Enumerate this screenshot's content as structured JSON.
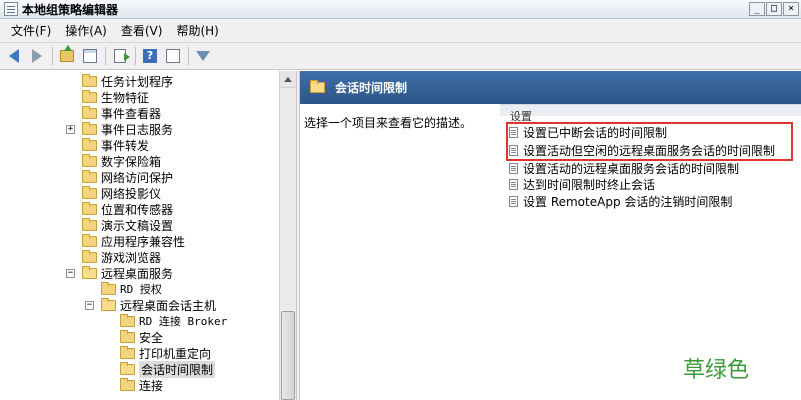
{
  "window": {
    "title": "本地组策略编辑器",
    "controls": [
      "_",
      "□",
      "×"
    ]
  },
  "menu": [
    "文件(F)",
    "操作(A)",
    "查看(V)",
    "帮助(H)"
  ],
  "toolbar": {
    "icons": [
      "back-arrow-icon",
      "forward-arrow-icon",
      "up-folder-icon",
      "show-hide-tree-icon",
      "export-list-icon",
      "help-icon",
      "properties-view-icon",
      "filter-icon"
    ]
  },
  "tree": {
    "items": [
      {
        "label": "任务计划程序",
        "expander": ""
      },
      {
        "label": "生物特征",
        "expander": ""
      },
      {
        "label": "事件查看器",
        "expander": ""
      },
      {
        "label": "事件日志服务",
        "expander": "+"
      },
      {
        "label": "事件转发",
        "expander": ""
      },
      {
        "label": "数字保险箱",
        "expander": ""
      },
      {
        "label": "网络访问保护",
        "expander": ""
      },
      {
        "label": "网络投影仪",
        "expander": ""
      },
      {
        "label": "位置和传感器",
        "expander": ""
      },
      {
        "label": "演示文稿设置",
        "expander": ""
      },
      {
        "label": "应用程序兼容性",
        "expander": ""
      },
      {
        "label": "游戏浏览器",
        "expander": ""
      },
      {
        "label": "远程桌面服务",
        "expander": "−"
      },
      {
        "label": "RD 授权",
        "expander": ""
      },
      {
        "label": "远程桌面会话主机",
        "expander": "−"
      },
      {
        "label": "RD 连接 Broker",
        "expander": ""
      },
      {
        "label": "安全",
        "expander": ""
      },
      {
        "label": "打印机重定向",
        "expander": ""
      },
      {
        "label": "会话时间限制",
        "expander": "",
        "selected": true
      },
      {
        "label": "连接",
        "expander": ""
      }
    ]
  },
  "right_pane": {
    "header_title": "会话时间限制",
    "description": "选择一个项目来查看它的描述。",
    "column_header": "设置",
    "settings": [
      "设置已中断会话的时间限制",
      "设置活动但空闲的远程桌面服务会话的时间限制",
      "设置活动的远程桌面服务会话的时间限制",
      "达到时间限制时终止会话",
      "设置 RemoteApp 会话的注销时间限制"
    ]
  },
  "watermark": "草绿色",
  "colors": {
    "header_bg": "#2c5689",
    "highlight": "#e0322e",
    "watermark": "#3a9a3a"
  }
}
